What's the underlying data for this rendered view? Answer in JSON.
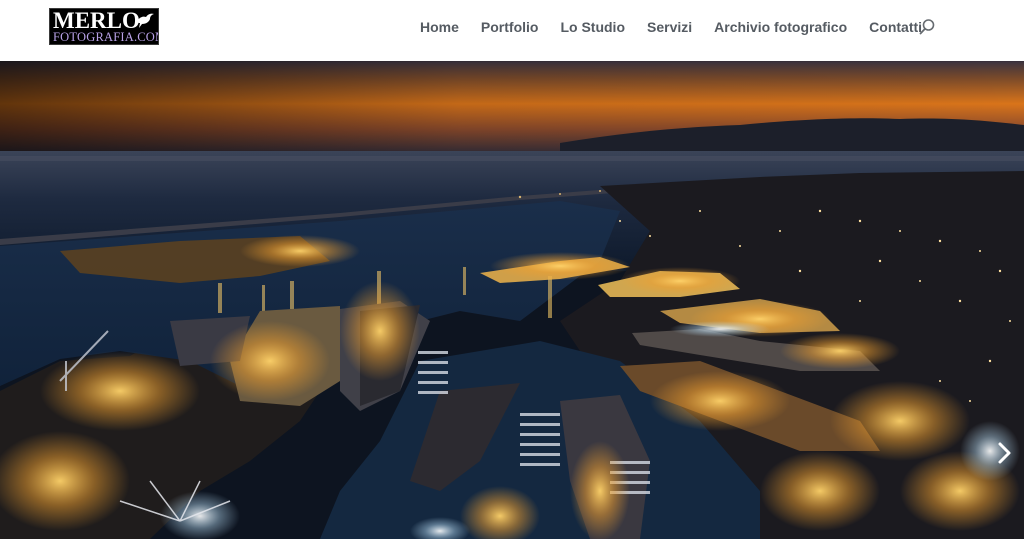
{
  "site": {
    "logo": {
      "line1": "MERLO",
      "line2": "FOTOGRAFIA.COM"
    }
  },
  "nav": {
    "items": [
      {
        "label": "Home"
      },
      {
        "label": "Portfolio"
      },
      {
        "label": "Lo Studio"
      },
      {
        "label": "Servizi"
      },
      {
        "label": "Archivio fotografico"
      },
      {
        "label": "Contatti"
      }
    ],
    "search_icon": "search-icon"
  },
  "hero": {
    "image_subject": "harbor-city-at-night",
    "next_icon": "chevron-right-icon"
  },
  "colors": {
    "nav_text": "#555b62",
    "logo_bg": "#000000",
    "logo_sub": "#b9a2e8",
    "sky_glow": "#f08a18"
  }
}
